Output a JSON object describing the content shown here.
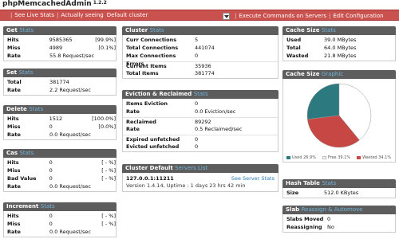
{
  "app": {
    "title": "phpMemcachedAdmin",
    "version": "1.2.2"
  },
  "nav": {
    "see_live_stats": "See Live Stats",
    "actually_seeing": "Actually seeing",
    "cluster_value": "Default cluster",
    "execute_commands": "Execute Commands on Servers",
    "edit_configuration": "Edit Configuration"
  },
  "get_stats": {
    "title": "Get",
    "accent": "Stats",
    "rows": [
      {
        "label": "Hits",
        "value": "9585365",
        "pct": "[99.9%]"
      },
      {
        "label": "Miss",
        "value": "4989",
        "pct": "[0.1%]"
      },
      {
        "label": "Rate",
        "value": "55.8 Request/sec",
        "pct": ""
      }
    ]
  },
  "set_stats": {
    "title": "Set",
    "accent": "Stats",
    "rows": [
      {
        "label": "Total",
        "value": "381774"
      },
      {
        "label": "Rate",
        "value": "2.2 Request/sec"
      }
    ]
  },
  "delete_stats": {
    "title": "Delete",
    "accent": "Stats",
    "rows": [
      {
        "label": "Hits",
        "value": "1512",
        "pct": "[100.0%]"
      },
      {
        "label": "Miss",
        "value": "0",
        "pct": "[0.0%]"
      },
      {
        "label": "Rate",
        "value": "0.0 Request/sec",
        "pct": ""
      }
    ]
  },
  "cas_stats": {
    "title": "Cas",
    "accent": "Stats",
    "rows": [
      {
        "label": "Hits",
        "value": "0",
        "pct": "[ - %]"
      },
      {
        "label": "Miss",
        "value": "0",
        "pct": "[ - %]"
      },
      {
        "label": "Bad Value",
        "value": "0",
        "pct": "[ - %]"
      },
      {
        "label": "Rate",
        "value": "0.0 Request/sec",
        "pct": ""
      }
    ]
  },
  "increment_stats": {
    "title": "Increment",
    "accent": "Stats",
    "rows": [
      {
        "label": "Hits",
        "value": "0",
        "pct": "[ - %]"
      },
      {
        "label": "Miss",
        "value": "0",
        "pct": "[ - %]"
      },
      {
        "label": "Rate",
        "value": "0.0 Request/sec",
        "pct": ""
      }
    ]
  },
  "cluster_stats": {
    "title": "Cluster",
    "accent": "Stats",
    "rows": [
      {
        "label": "Curr Connections",
        "value": "5"
      },
      {
        "label": "Total Connections",
        "value": "441074"
      },
      {
        "label": "Max Connections Errors",
        "value": "0"
      },
      {
        "label": "Current Items",
        "value": "35936"
      },
      {
        "label": "Total Items",
        "value": "381774"
      }
    ]
  },
  "eviction_stats": {
    "title": "Eviction & Reclaimed",
    "accent": "Stats",
    "rows": [
      {
        "label": "Items Eviction",
        "value": "0"
      },
      {
        "label": "Rate",
        "value": "0.0 Eviction/sec"
      },
      {
        "label": "Reclaimed",
        "value": "89292"
      },
      {
        "label": "Rate",
        "value": "0.5 Reclaimed/sec"
      },
      {
        "label": "Expired unfetched",
        "value": "0"
      },
      {
        "label": "Evicted unfetched",
        "value": "0"
      }
    ]
  },
  "servers_list": {
    "title": "Cluster Default",
    "accent": "Servers List",
    "host": "127.0.0.1:11211",
    "link": "See Server Stats",
    "info": "Version 1.4.14, Uptime : 1 days 23 hrs 42 min"
  },
  "cache_size_stats": {
    "title": "Cache Size",
    "accent": "Stats",
    "rows": [
      {
        "label": "Used",
        "value": "39.0 MBytes"
      },
      {
        "label": "Total",
        "value": "64.0 MBytes"
      },
      {
        "label": "Wasted",
        "value": "21.8 MBytes"
      }
    ]
  },
  "cache_size_graphic": {
    "title": "Cache Size",
    "accent": "Graphic",
    "legend": [
      {
        "label": "Used 26.9%",
        "color": "#2c7a80"
      },
      {
        "label": "Free 39.1%",
        "color": "#ffffff"
      },
      {
        "label": "Wasted 34.1%",
        "color": "#c64743"
      }
    ]
  },
  "chart_data": {
    "type": "pie",
    "categories": [
      "Used",
      "Free",
      "Wasted"
    ],
    "values": [
      26.9,
      39.1,
      34.1
    ],
    "colors": [
      "#2c7a80",
      "#ffffff",
      "#c64743"
    ]
  },
  "hash_table": {
    "title": "Hash Table",
    "accent": "Stats",
    "rows": [
      {
        "label": "Size",
        "value": "512.0 KBytes"
      }
    ]
  },
  "slab_stats": {
    "title": "Slab",
    "accent": "Reassign & Automove",
    "rows": [
      {
        "label": "Slabs Moved",
        "value": "0"
      },
      {
        "label": "Reassigning",
        "value": "No"
      }
    ]
  }
}
